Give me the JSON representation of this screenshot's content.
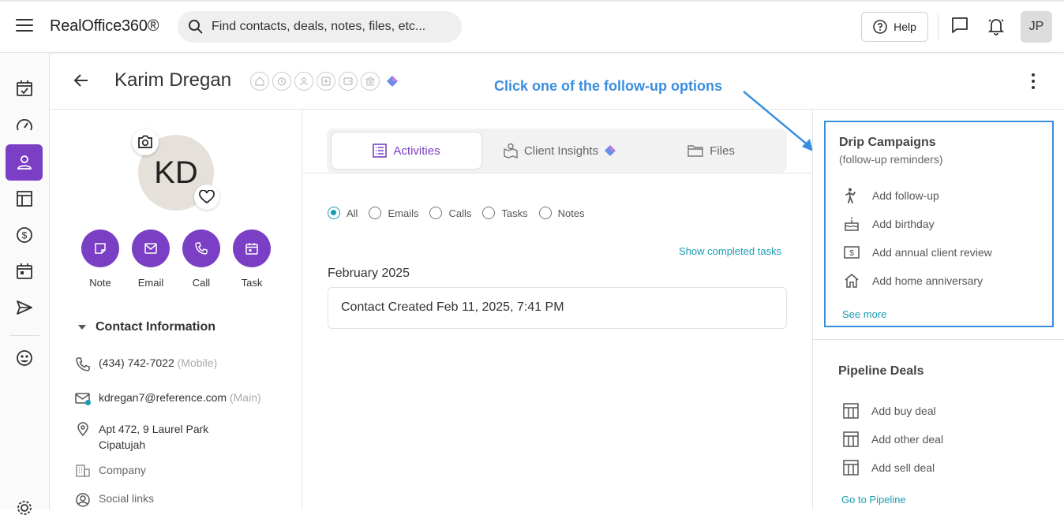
{
  "app": {
    "brand": "RealOffice360®",
    "search_placeholder": "Find contacts, deals, notes, files, etc...",
    "help_label": "Help",
    "user_initials": "JP"
  },
  "leftnav": [
    "calendar-check-icon",
    "speedometer-icon",
    "contacts-icon",
    "layout-icon",
    "dollar-icon",
    "calendar-icon",
    "send-icon",
    "smiley-icon",
    "settings-icon"
  ],
  "header": {
    "contact_name": "Karim Dregan",
    "annotation": "Click one of the follow-up options"
  },
  "profile": {
    "initials": "KD",
    "actions": [
      {
        "label": "Note"
      },
      {
        "label": "Email"
      },
      {
        "label": "Call"
      },
      {
        "label": "Task"
      }
    ],
    "contact_info_title": "Contact Information",
    "phone": "(434) 742-7022",
    "phone_type": "(Mobile)",
    "email": "kdregan7@reference.com",
    "email_type": "(Main)",
    "address_line1": "Apt 472, 9 Laurel Park",
    "address_line2": "Cipatujah",
    "company_label": "Company",
    "social_label": "Social links"
  },
  "tabs": [
    {
      "label": "Activities",
      "active": true
    },
    {
      "label": "Client Insights",
      "active": false
    },
    {
      "label": "Files",
      "active": false
    }
  ],
  "filters": [
    {
      "label": "All",
      "selected": true
    },
    {
      "label": "Emails",
      "selected": false
    },
    {
      "label": "Calls",
      "selected": false
    },
    {
      "label": "Tasks",
      "selected": false
    },
    {
      "label": "Notes",
      "selected": false
    }
  ],
  "activities": {
    "show_completed": "Show completed tasks",
    "month": "February 2025",
    "entry": "Contact Created Feb 11, 2025, 7:41 PM"
  },
  "drip": {
    "title": "Drip Campaigns",
    "subtitle": "(follow-up reminders)",
    "items": [
      "Add follow-up",
      "Add birthday",
      "Add annual client review",
      "Add home anniversary"
    ],
    "see_more": "See more"
  },
  "pipeline": {
    "title": "Pipeline Deals",
    "items": [
      "Add buy deal",
      "Add other deal",
      "Add sell deal"
    ],
    "go_to": "Go to Pipeline"
  },
  "colors": {
    "accent": "#7a3fc4",
    "link": "#1a9cb0",
    "annotation": "#3b8de0"
  }
}
